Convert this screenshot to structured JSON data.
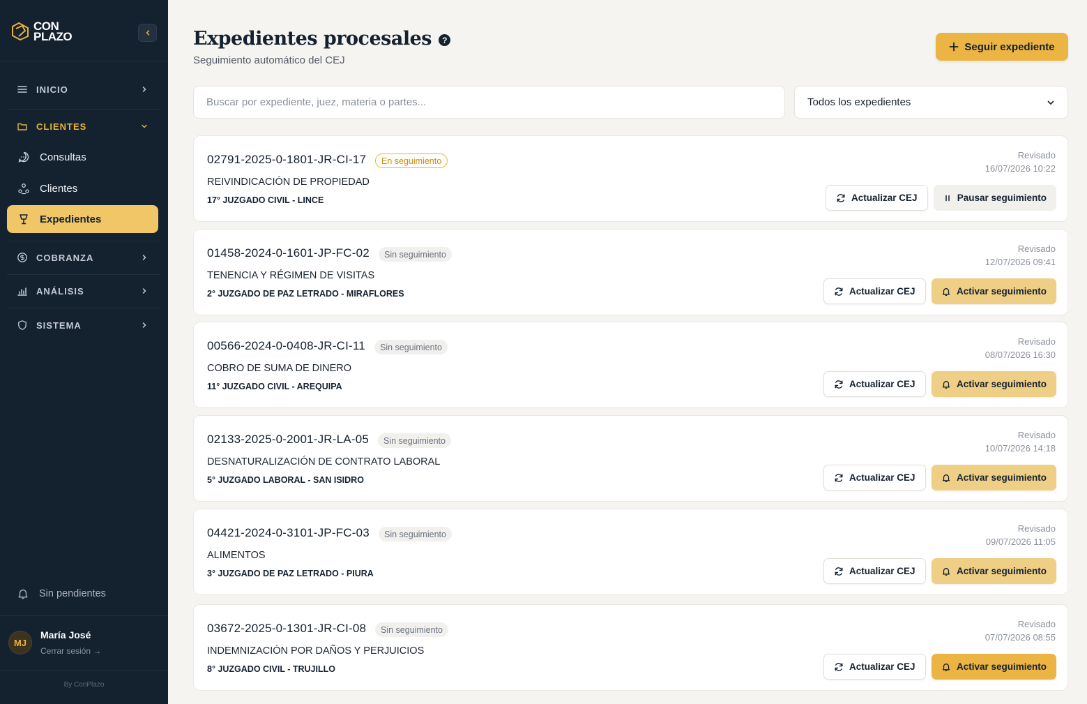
{
  "brand": {
    "line1": "CON",
    "line2": "PLAZO",
    "accent": "#e9b43a",
    "sidebar_bg": "#14212f"
  },
  "sidebar": {
    "nav": [
      {
        "id": "inicio",
        "label": "INICIO",
        "icon": "menu-icon"
      },
      {
        "id": "clientes",
        "label": "CLIENTES",
        "icon": "folder-icon",
        "expanded": true
      },
      {
        "id": "cobranza",
        "label": "COBRANZA",
        "icon": "coin-icon"
      },
      {
        "id": "analisis",
        "label": "ANÁLISIS",
        "icon": "bar-chart-icon"
      },
      {
        "id": "sistema",
        "label": "SISTEMA",
        "icon": "shield-icon"
      }
    ],
    "sub": [
      {
        "label": "Consultas",
        "icon": "chat-icon"
      },
      {
        "label": "Clientes",
        "icon": "users-icon"
      },
      {
        "label": "Expedientes",
        "icon": "gavel-icon",
        "active": true
      }
    ],
    "pending": "Sin pendientes",
    "user": {
      "initials": "MJ",
      "name": "María José",
      "logout": "Cerrar sesión →"
    },
    "byline": "By ConPlazo"
  },
  "header": {
    "title": "Expedientes procesales",
    "subtitle": "Seguimiento automático del CEJ",
    "primary_button": "Seguir expediente"
  },
  "filters": {
    "search_placeholder": "Buscar por expediente, juez, materia o partes...",
    "select_value": "Todos los expedientes"
  },
  "labels": {
    "reviewed": "Revisado",
    "update": "Actualizar CEJ",
    "pause": "Pausar seguimiento",
    "activate": "Activar seguimiento"
  },
  "cases": [
    {
      "id": "02791-2025-0-1801-JR-CI-17",
      "status": "En seguimiento",
      "tracking": true,
      "matter": "REIVINDICACIÓN DE PROPIEDAD",
      "court": "17° JUZGADO CIVIL - LINCE",
      "reviewed": "16/07/2026 10:22"
    },
    {
      "id": "01458-2024-0-1601-JP-FC-02",
      "status": "Sin seguimiento",
      "tracking": false,
      "matter": "TENENCIA Y RÉGIMEN DE VISITAS",
      "court": "2° JUZGADO DE PAZ LETRADO - MIRAFLORES",
      "reviewed": "12/07/2026 09:41"
    },
    {
      "id": "00566-2024-0-0408-JR-CI-11",
      "status": "Sin seguimiento",
      "tracking": false,
      "matter": "COBRO DE SUMA DE DINERO",
      "court": "11° JUZGADO CIVIL - AREQUIPA",
      "reviewed": "08/07/2026 16:30"
    },
    {
      "id": "02133-2025-0-2001-JR-LA-05",
      "status": "Sin seguimiento",
      "tracking": false,
      "matter": "DESNATURALIZACIÓN DE CONTRATO LABORAL",
      "court": "5° JUZGADO LABORAL - SAN ISIDRO",
      "reviewed": "10/07/2026 14:18"
    },
    {
      "id": "04421-2024-0-3101-JP-FC-03",
      "status": "Sin seguimiento",
      "tracking": false,
      "matter": "ALIMENTOS",
      "court": "3° JUZGADO DE PAZ LETRADO - PIURA",
      "reviewed": "09/07/2026 11:05"
    },
    {
      "id": "03672-2025-0-1301-JR-CI-08",
      "status": "Sin seguimiento",
      "tracking": false,
      "matter": "INDEMNIZACIÓN POR DAÑOS Y PERJUICIOS",
      "court": "8° JUZGADO CIVIL - TRUJILLO",
      "reviewed": "07/07/2026 08:55"
    }
  ]
}
